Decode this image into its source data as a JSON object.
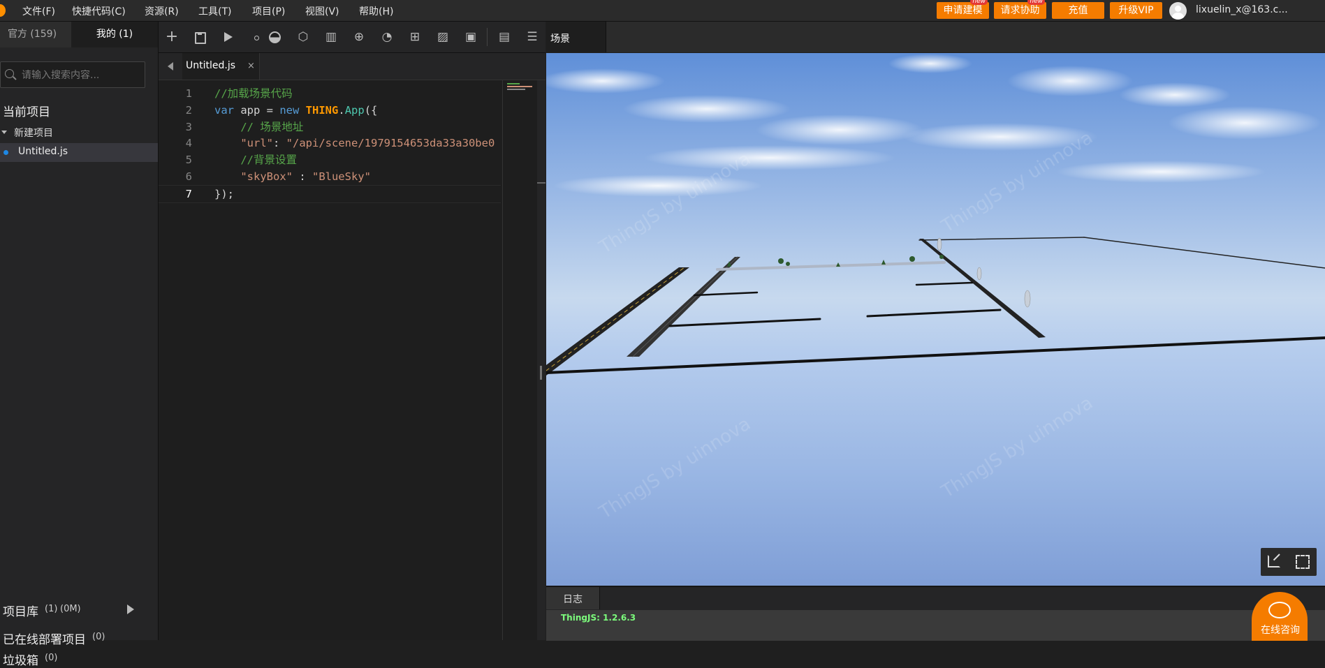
{
  "menu": {
    "items": [
      "文件(F)",
      "快捷代码(C)",
      "资源(R)",
      "工具(T)",
      "项目(P)",
      "视图(V)",
      "帮助(H)"
    ],
    "apply_model": "申请建模",
    "request_help": "请求协助",
    "new_badge": "new",
    "recharge": "充值",
    "upgrade_vip": "升级VIP",
    "username": "lixuelin_x@163.c..."
  },
  "left": {
    "tab_official": "官方 (159)",
    "tab_mine": "我的 (1)",
    "search_placeholder": "请输入搜索内容...",
    "current_project_title": "当前项目",
    "project_name": "新建项目",
    "file_name": "Untitled.js",
    "library_label": "项目库",
    "library_count": "(1)",
    "library_size": "(0M)",
    "deployed_label": "已在线部署项目",
    "deployed_count": "(0)",
    "trash_label": "垃圾箱",
    "trash_count": "(0)"
  },
  "editor": {
    "file_tab": "Untitled.js",
    "close_glyph": "×",
    "line_numbers": [
      "1",
      "2",
      "3",
      "4",
      "5",
      "6",
      "7"
    ],
    "lines": [
      [
        {
          "t": "//加载场景代码",
          "c": "c-com"
        }
      ],
      [
        {
          "t": "var",
          "c": "c-kw"
        },
        {
          "t": " app = ",
          "c": "c-id"
        },
        {
          "t": "new",
          "c": "c-kw"
        },
        {
          "t": " ",
          "c": "c-id"
        },
        {
          "t": "THING",
          "c": "c-cls"
        },
        {
          "t": ".",
          "c": "c-id"
        },
        {
          "t": "App",
          "c": "c-fn"
        },
        {
          "t": "({",
          "c": "c-id"
        }
      ],
      [
        {
          "t": "    // 场景地址",
          "c": "c-com"
        }
      ],
      [
        {
          "t": "    ",
          "c": "c-id"
        },
        {
          "t": "\"url\"",
          "c": "c-str"
        },
        {
          "t": ": ",
          "c": "c-id"
        },
        {
          "t": "\"/api/scene/1979154653da33a30be0",
          "c": "c-str"
        }
      ],
      [
        {
          "t": "    //背景设置",
          "c": "c-com"
        }
      ],
      [
        {
          "t": "    ",
          "c": "c-id"
        },
        {
          "t": "\"skyBox\"",
          "c": "c-str"
        },
        {
          "t": " : ",
          "c": "c-id"
        },
        {
          "t": "\"BlueSky\"",
          "c": "c-str"
        }
      ],
      [
        {
          "t": "});",
          "c": "c-id"
        }
      ]
    ]
  },
  "scene": {
    "tab_label": "场景",
    "watermark": "ThingJS by uinnova",
    "log_tab": "日志",
    "version_text": "ThingJS: 1.2.6.3",
    "chat_label": "在线咨询"
  }
}
